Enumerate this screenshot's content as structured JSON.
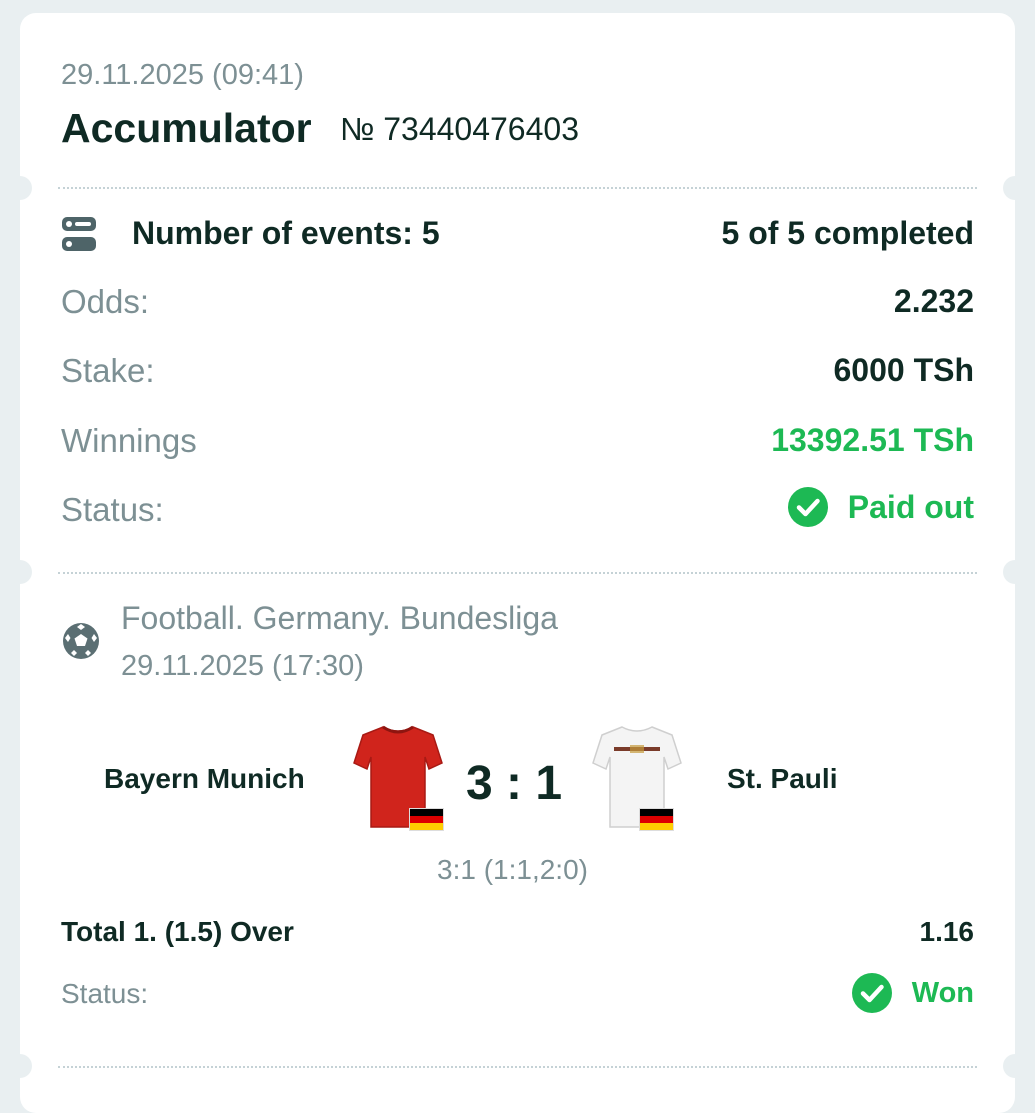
{
  "header": {
    "datetime": "29.11.2025 (09:41)",
    "bet_type": "Accumulator",
    "bet_number": "№ 73440476403"
  },
  "summary": {
    "events_label": "Number of events: 5",
    "completed_text": "5 of 5 completed",
    "odds_label": "Odds:",
    "odds_value": "2.232",
    "stake_label": "Stake:",
    "stake_value": "6000 TSh",
    "winnings_label": "Winnings",
    "winnings_value": "13392.51 TSh",
    "status_label": "Status:",
    "status_value": "Paid out"
  },
  "event": {
    "league": "Football. Germany. Bundesliga",
    "datetime": "29.11.2025 (17:30)",
    "home_team": "Bayern Munich",
    "away_team": "St. Pauli",
    "score": "3 : 1",
    "score_detail": "3:1 (1:1,2:0)",
    "market": "Total 1. (1.5) Over",
    "market_odds": "1.16",
    "status_label": "Status:",
    "status_value": "Won"
  },
  "colors": {
    "accent_green": "#1db954",
    "text_dark": "#0f2a24",
    "text_muted": "#7d9094",
    "home_kit": "#d0241c",
    "away_kit": "#f2f2f2"
  },
  "icons": {
    "events": "list-toggle-icon",
    "sport": "football-icon",
    "status": "checkmark-circle-icon",
    "home_flag": "germany-flag-icon",
    "away_flag": "germany-flag-icon"
  }
}
